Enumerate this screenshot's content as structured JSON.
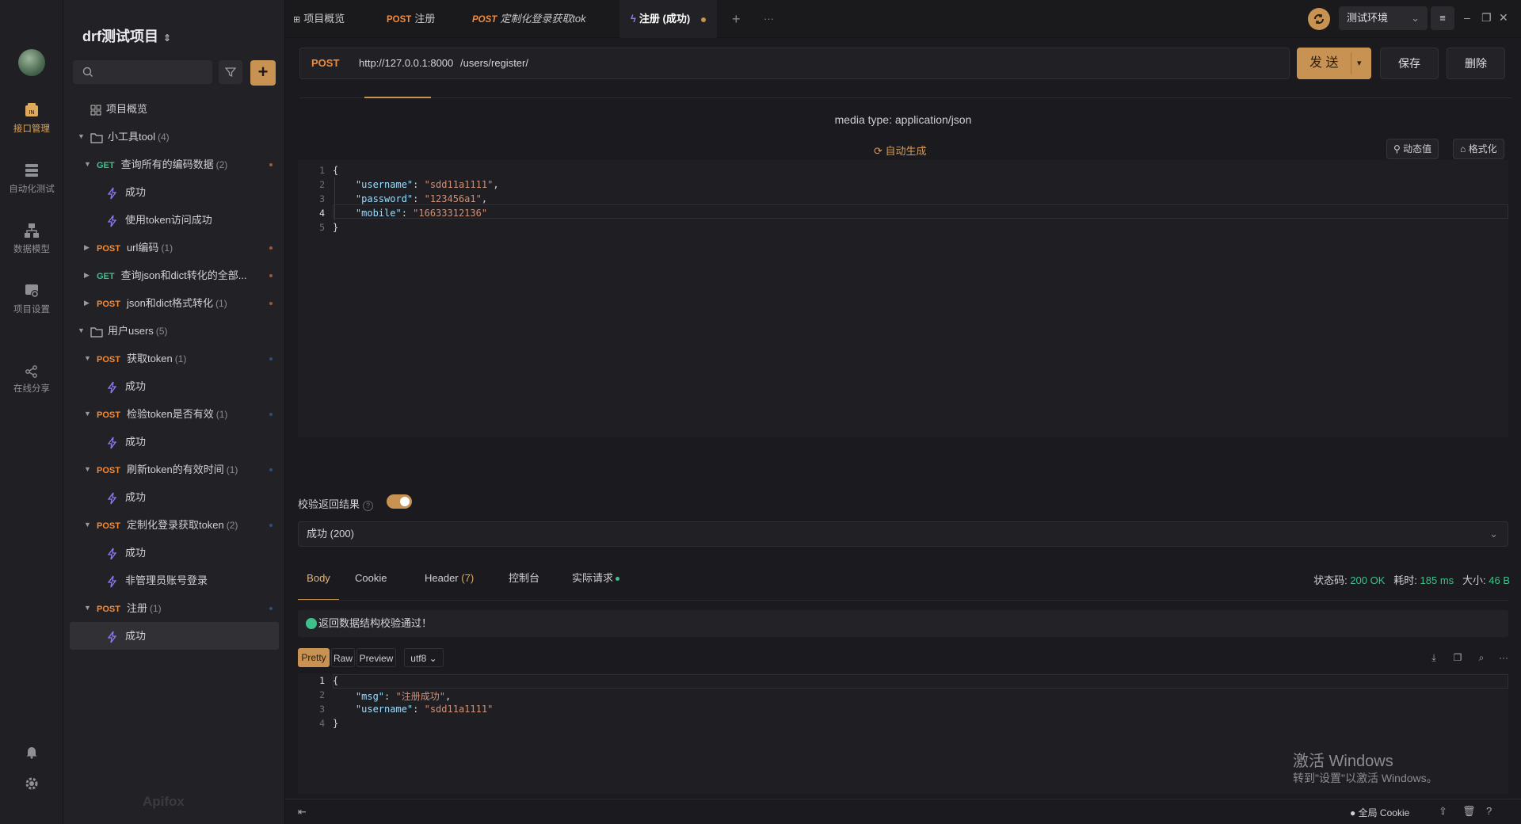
{
  "rail": {
    "items": [
      {
        "label": "接口管理"
      },
      {
        "label": "自动化测试"
      },
      {
        "label": "数据模型"
      },
      {
        "label": "项目设置"
      },
      {
        "label": "在线分享"
      }
    ]
  },
  "sidebar": {
    "project_title": "drf测试项目",
    "overview": "项目概览",
    "folder_tool": {
      "name": "小工具tool",
      "count": "(4)"
    },
    "api_get_encode": {
      "method": "GET",
      "name": "查询所有的编码数据",
      "count": "(2)"
    },
    "case_success": "成功",
    "case_token_access": "使用token访问成功",
    "api_url_encode": {
      "method": "POST",
      "name": "url编码",
      "count": "(1)"
    },
    "api_get_json": {
      "method": "GET",
      "name": "查询json和dict转化的全部..."
    },
    "api_json_dict": {
      "method": "POST",
      "name": "json和dict格式转化",
      "count": "(1)"
    },
    "folder_users": {
      "name": "用户users",
      "count": "(5)"
    },
    "api_get_token": {
      "method": "POST",
      "name": "获取token",
      "count": "(1)"
    },
    "api_check_token": {
      "method": "POST",
      "name": "检验token是否有效",
      "count": "(1)"
    },
    "api_refresh_token": {
      "method": "POST",
      "name": "刷新token的有效时间",
      "count": "(1)"
    },
    "api_custom_login": {
      "method": "POST",
      "name": "定制化登录获取token",
      "count": "(2)"
    },
    "case_non_admin": "非管理员账号登录",
    "api_register": {
      "method": "POST",
      "name": "注册",
      "count": "(1)"
    },
    "brand": "Apifox"
  },
  "tabs": [
    {
      "label": "项目概览"
    },
    {
      "method": "POST",
      "label": "注册"
    },
    {
      "method": "POST",
      "label": "定制化登录获取tok"
    },
    {
      "label": "注册 (成功)"
    }
  ],
  "env": {
    "name": "测试环境"
  },
  "request": {
    "method": "POST",
    "base_url": "http://127.0.0.1:8000",
    "path": "/users/register/",
    "send": "发 送",
    "save": "保存",
    "delete": "删除",
    "media_type": "media type: application/json",
    "auto_generate": "自动生成",
    "dynamic_value": "动态值",
    "format": "格式化",
    "body_lines": {
      "l1": "{",
      "k2": "\"username\"",
      "v2": "\"sdd11a1111\"",
      "k3": "\"password\"",
      "v3": "\"123456a1\"",
      "k4": "\"mobile\"",
      "v4": "\"16633312136\"",
      "l5": "}"
    }
  },
  "validation": {
    "label": "校验返回结果",
    "enabled": true,
    "selected": "成功 (200)",
    "pass_message": "返回数据结构校验通过！"
  },
  "response": {
    "tabs": [
      "Body",
      "Cookie",
      "Header",
      "控制台",
      "实际请求"
    ],
    "header_count": "(7)",
    "status_label": "状态码:",
    "status_value": "200 OK",
    "time_label": "耗时:",
    "time_value": "185 ms",
    "size_label": "大小:",
    "size_value": "46 B",
    "formats": [
      "Pretty",
      "Raw",
      "Preview"
    ],
    "encoding": "utf8",
    "body_lines": {
      "l1": "{",
      "k2": "\"msg\"",
      "v2": "\"注册成功\"",
      "k3": "\"username\"",
      "v3": "\"sdd11a1111\"",
      "l4": "}"
    }
  },
  "watermark": {
    "line1": "激活 Windows",
    "line2": "转到\"设置\"以激活 Windows。"
  },
  "footer": {
    "global_cookie": "全局 Cookie"
  },
  "colors": {
    "accent": "#c89252",
    "post": "#f08b3c",
    "get": "#3fc08a",
    "success": "#3fc08a"
  }
}
